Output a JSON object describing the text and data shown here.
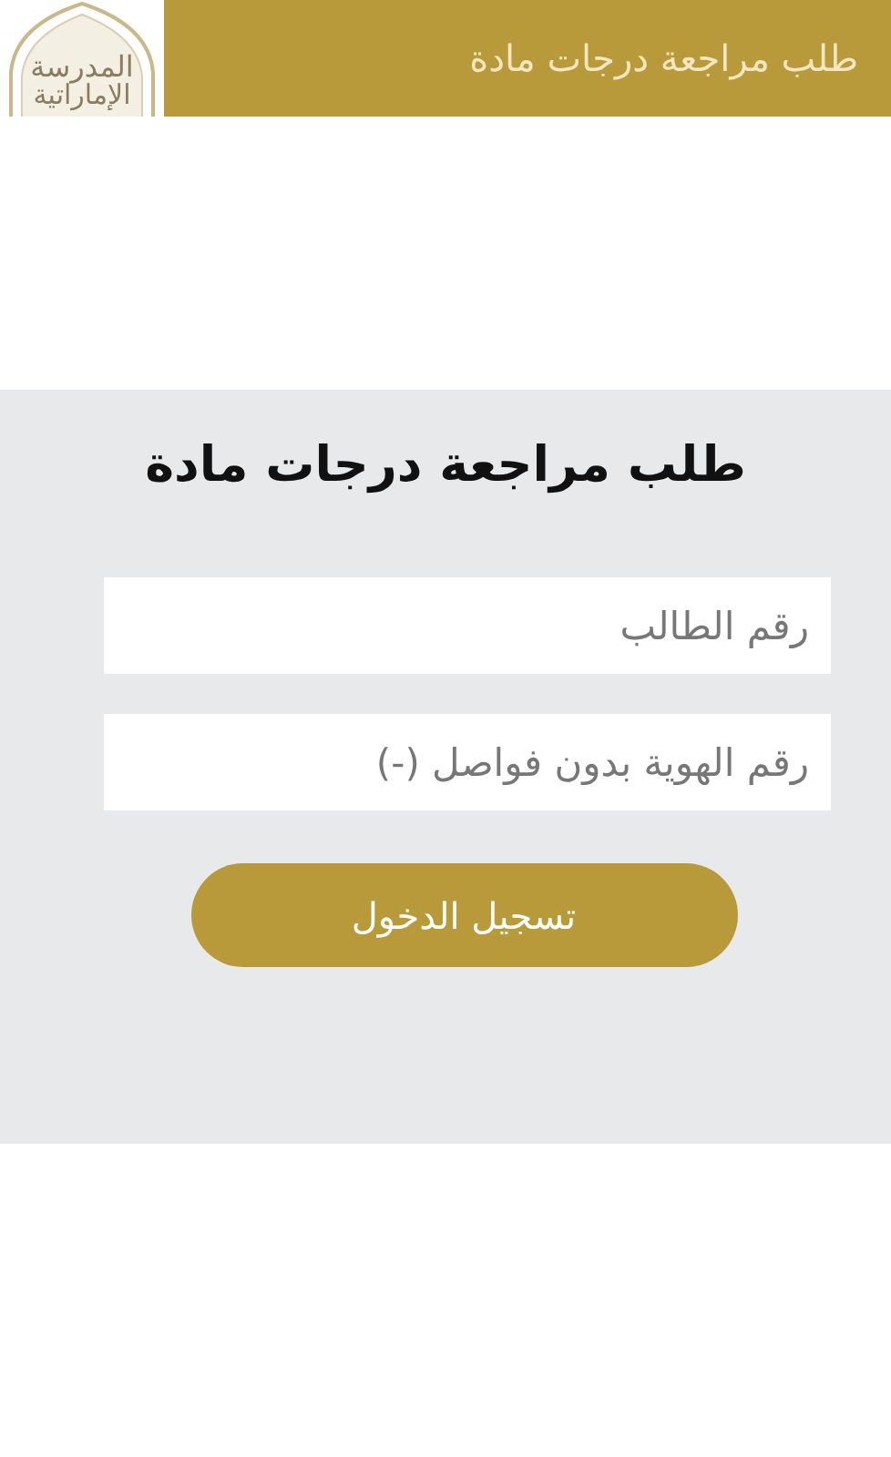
{
  "header": {
    "title": "طلب مراجعة درجات مادة",
    "logo": {
      "line_1": "المدرسة",
      "line_2": "الإماراتية"
    }
  },
  "form": {
    "title": "طلب مراجعة درجات مادة",
    "fields": [
      {
        "placeholder": "رقم الطالب"
      },
      {
        "placeholder": "رقم الهوية بدون فواصل (-)"
      }
    ],
    "submit": "تسجيل الدخول"
  }
}
